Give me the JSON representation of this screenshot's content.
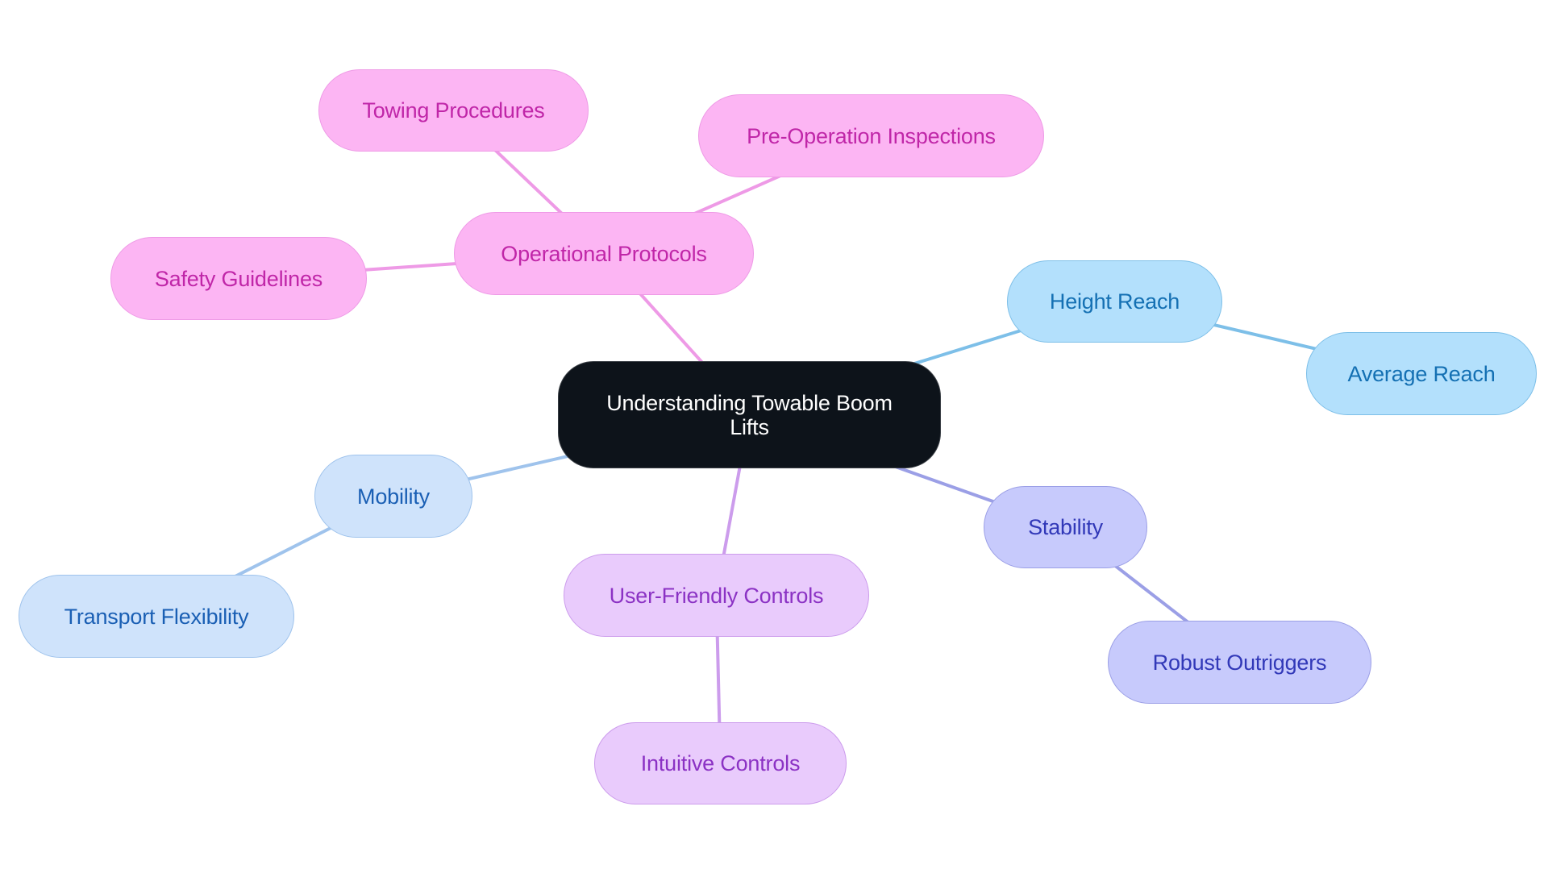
{
  "diagram": {
    "type": "mindmap",
    "root": {
      "id": "root",
      "label": "Understanding Towable Boom Lifts",
      "fill": "#0d131a",
      "stroke": "#3a3f45",
      "text": "#ffffff"
    },
    "branches": [
      {
        "id": "operational",
        "label": "Operational Protocols",
        "theme": {
          "fill": "#fcb5f3",
          "stroke": "#ee9ae6",
          "text": "#c026a8",
          "edge": "#ee9ae6"
        },
        "children": [
          {
            "id": "towing",
            "label": "Towing Procedures"
          },
          {
            "id": "preop",
            "label": "Pre-Operation Inspections"
          },
          {
            "id": "safety",
            "label": "Safety Guidelines"
          }
        ]
      },
      {
        "id": "height",
        "label": "Height Reach",
        "theme": {
          "fill": "#b3e0fc",
          "stroke": "#7dbfe8",
          "text": "#1470b3",
          "edge": "#7dbfe8"
        },
        "children": [
          {
            "id": "avgreach",
            "label": "Average Reach"
          }
        ]
      },
      {
        "id": "mobility",
        "label": "Mobility",
        "theme": {
          "fill": "#cfe3fb",
          "stroke": "#9fc3ec",
          "text": "#1a5fb4",
          "edge": "#9fc3ec"
        },
        "children": [
          {
            "id": "transport",
            "label": "Transport Flexibility"
          }
        ]
      },
      {
        "id": "stability",
        "label": "Stability",
        "theme": {
          "fill": "#c7cafc",
          "stroke": "#9b9fe6",
          "text": "#3138b8",
          "edge": "#9b9fe6"
        },
        "children": [
          {
            "id": "outriggers",
            "label": "Robust Outriggers"
          }
        ]
      },
      {
        "id": "userfriendly",
        "label": "User-Friendly Controls",
        "theme": {
          "fill": "#e9cbfc",
          "stroke": "#cc9cec",
          "text": "#8b32c4",
          "edge": "#cc9cec"
        },
        "children": [
          {
            "id": "intuitive",
            "label": "Intuitive Controls"
          }
        ]
      }
    ]
  }
}
